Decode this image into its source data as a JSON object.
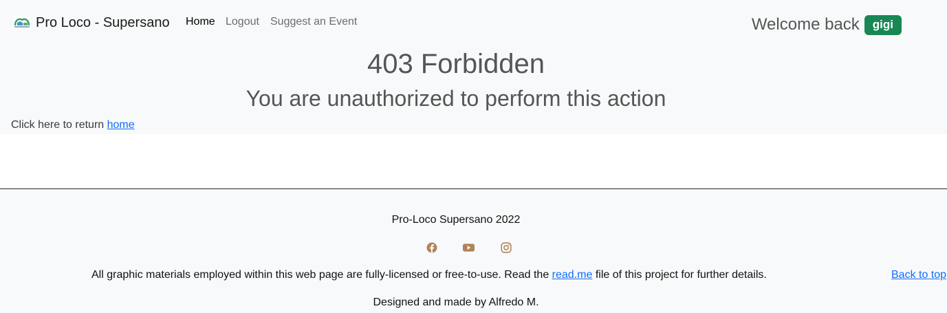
{
  "navbar": {
    "brand": "Pro Loco - Supersano",
    "logo_icon": "tree-house-logo-icon",
    "links": [
      {
        "label": "Home",
        "active": true
      },
      {
        "label": "Logout",
        "active": false
      },
      {
        "label": "Suggest an Event",
        "active": false
      }
    ],
    "welcome_text": "Welcome back",
    "username": "gigi",
    "badge_color": "#198754"
  },
  "content": {
    "title": "403 Forbidden",
    "subtitle": "You are unauthorized to perform this action",
    "return_prefix": "Click here to return",
    "return_link": "home"
  },
  "footer": {
    "copyright": "Pro-Loco Supersano 2022",
    "social_icons": [
      "facebook-icon",
      "youtube-icon",
      "instagram-icon"
    ],
    "social_color": "#b08457",
    "license_prefix": "All graphic materials employed within this web page are fully-licensed or free-to-use. Read the",
    "license_link": "read.me",
    "license_suffix": "file of this project for further details.",
    "back_to_top": "Back to top",
    "designed_by": "Designed and made by Alfredo M."
  }
}
